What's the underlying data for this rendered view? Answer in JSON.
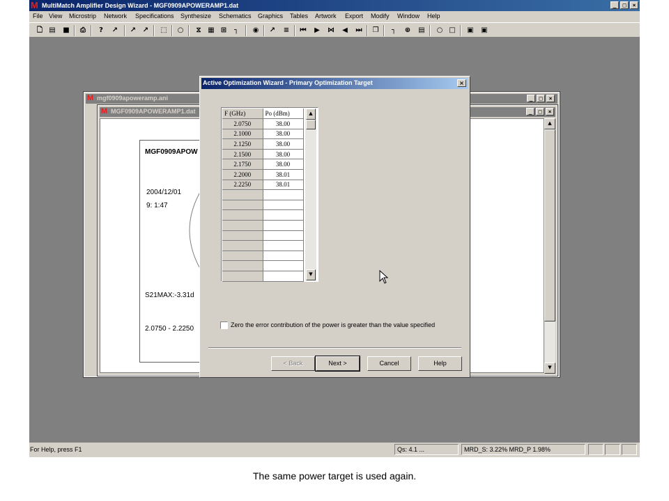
{
  "app": {
    "title": "MultiMatch Amplifier Design Wizard - MGF0909APOWERAMP1.dat",
    "logo": "M",
    "caption_buttons": [
      "_",
      "□",
      "×"
    ]
  },
  "menu": [
    "File",
    "View",
    "Microstrip",
    "Network",
    "Specifications",
    "Synthesize",
    "Schematics",
    "Graphics",
    "Tables",
    "Artwork",
    "Export",
    "Modify",
    "Window",
    "Help"
  ],
  "toolbar": {
    "icons": [
      "new-file-icon",
      "open-folder-icon",
      "save-icon",
      "print-icon",
      "help-icon",
      "context-help-icon",
      "arrow-tool-icon",
      "arrow-tool2-icon",
      "port-icon",
      "circle-icon",
      "hourglass-icon",
      "grid-icon",
      "block-icon",
      "network-icon",
      "target-icon",
      "probe-icon",
      "component-icon",
      "first-icon",
      "play-icon",
      "step-icon",
      "back-icon",
      "end-icon",
      "copy-icon",
      "tuner-icon",
      "tune-icon",
      "box-icon",
      "circle2-icon",
      "square-icon",
      "lock-icon",
      "unlock-icon"
    ]
  },
  "child_window_1": {
    "title": "mgf0909apoweramp.ani"
  },
  "child_window_2": {
    "title": "MGF0909APOWERAMP1.dat"
  },
  "report": {
    "title": "MGF0909APOW",
    "date": "2004/12/01",
    "time": "9: 1:47",
    "s21": "S21MAX:-3.31d",
    "range": "2.0750 - 2.2250"
  },
  "dialog": {
    "title": "Active Optimization Wizard - Primary Optimization Target",
    "close": "×",
    "table": {
      "headers": [
        "F (GHz)",
        "Po (dBm)"
      ],
      "rows": [
        [
          "2.0750",
          "38.00"
        ],
        [
          "2.1000",
          "38.00"
        ],
        [
          "2.1250",
          "38.00"
        ],
        [
          "2.1500",
          "38.00"
        ],
        [
          "2.1750",
          "38.00"
        ],
        [
          "2.2000",
          "38.01"
        ],
        [
          "2.2250",
          "38.01"
        ],
        [
          "",
          ""
        ],
        [
          "",
          ""
        ],
        [
          "",
          ""
        ],
        [
          "",
          ""
        ],
        [
          "",
          ""
        ],
        [
          "",
          ""
        ],
        [
          "",
          ""
        ],
        [
          "",
          ""
        ],
        [
          "",
          ""
        ]
      ]
    },
    "checkbox_label": "Zero the error contribution of the power is greater than the value specified",
    "checkbox_checked": false,
    "buttons": {
      "back": "< Back",
      "next": "Next >",
      "cancel": "Cancel",
      "help": "Help"
    }
  },
  "status": {
    "help": "For Help, press F1",
    "qs": "Qs:   4.1 ...",
    "mrd": "MRD_S:  3.22% MRD_P  1.98%"
  },
  "caption": "The same power target is used again."
}
